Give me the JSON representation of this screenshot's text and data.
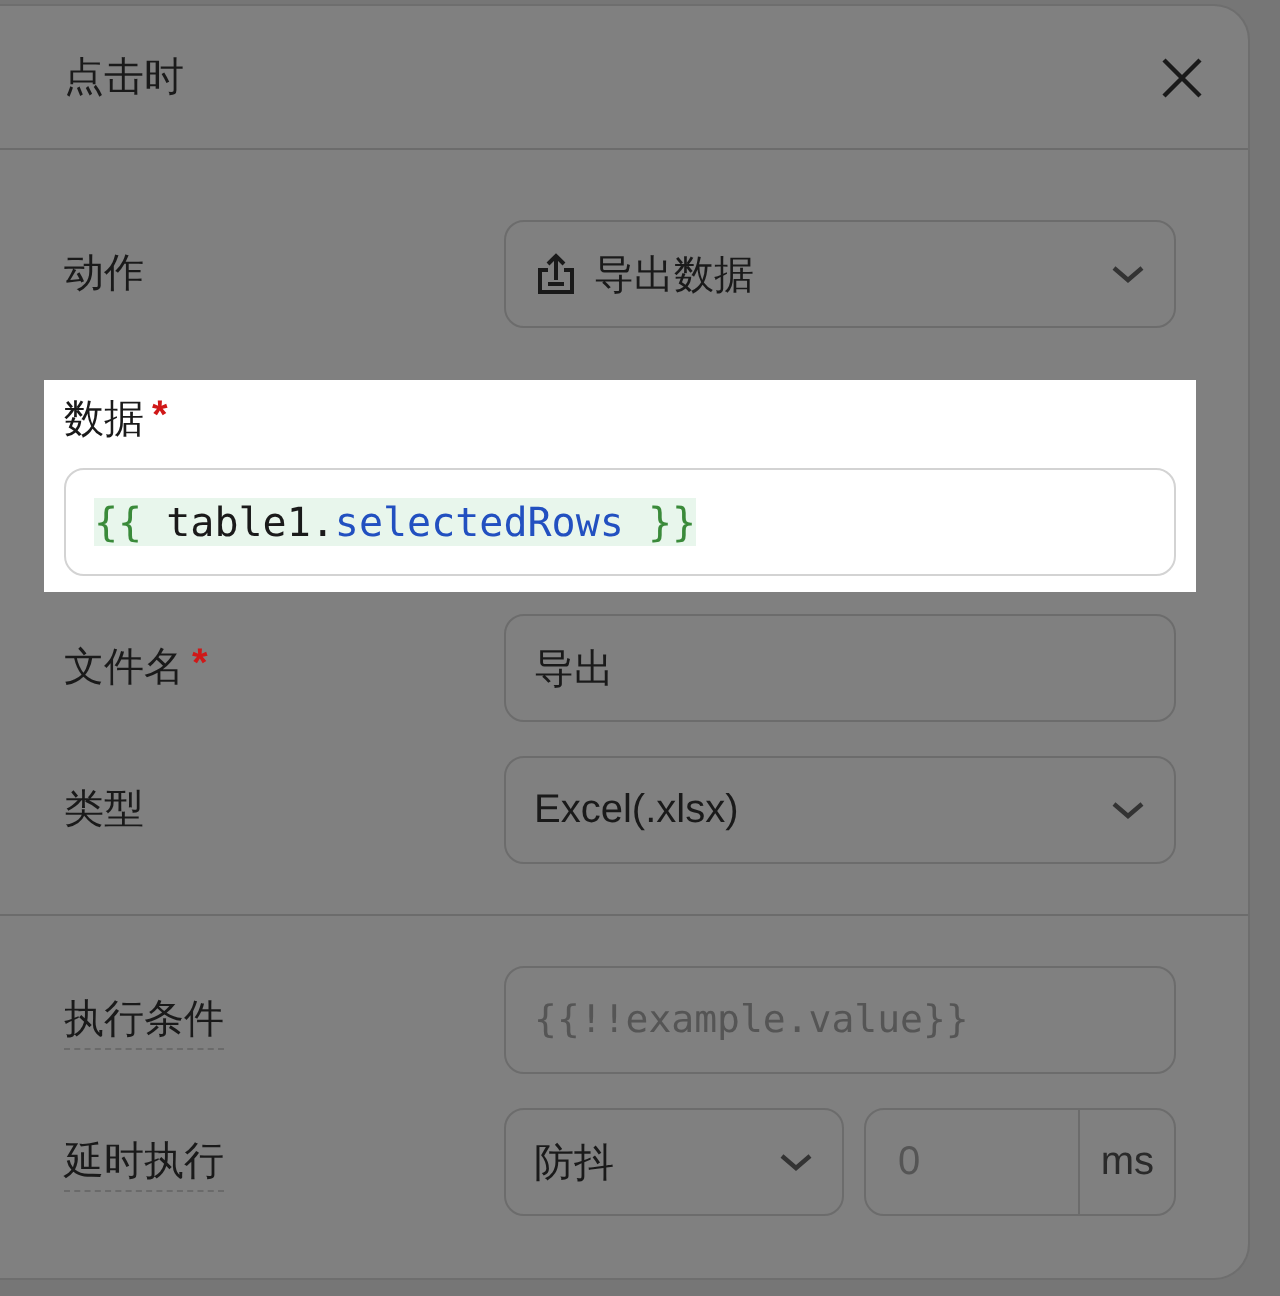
{
  "dialog": {
    "title": "点击时"
  },
  "sections": [
    {
      "spotlight": false,
      "fields": [
        {
          "label": "动作",
          "kind": "action_select",
          "value": "导出数据"
        }
      ]
    },
    {
      "spotlight": true,
      "fields": [
        {
          "label": "数据",
          "required_mark": "*",
          "kind": "code",
          "stacked": true,
          "tokens": [
            {
              "text": "{{ ",
              "kind": "brace"
            },
            {
              "text": "table1.",
              "kind": "plain"
            },
            {
              "text": "selectedRows",
              "kind": "property"
            },
            {
              "text": " }}",
              "kind": "brace"
            }
          ]
        }
      ]
    },
    {
      "spotlight": false,
      "fields": [
        {
          "label": "文件名",
          "required_mark": "*",
          "kind": "input",
          "value": "导出"
        },
        {
          "label": "类型",
          "kind": "select",
          "value": "Excel(.xlsx)"
        }
      ]
    },
    {
      "spotlight": false,
      "divider": true,
      "fields": [
        {
          "label": "执行条件",
          "hint": true,
          "kind": "code_input",
          "placeholder": "{{!!example.value}}"
        },
        {
          "label": "延时执行",
          "hint": true,
          "kind": "delay",
          "value": "防抖",
          "amount_placeholder": "0",
          "unit": "ms"
        }
      ]
    }
  ]
}
